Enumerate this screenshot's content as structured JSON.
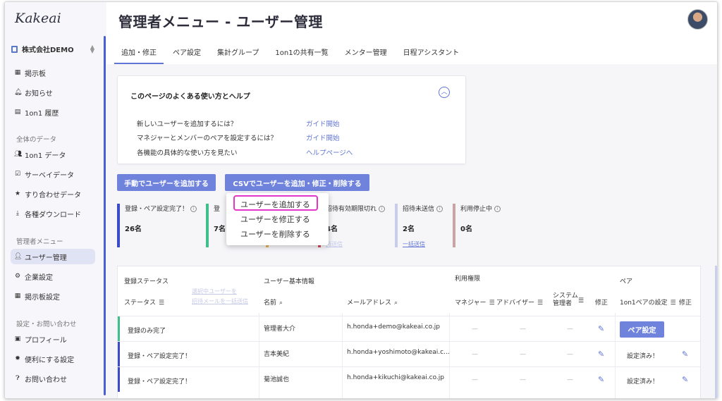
{
  "app": {
    "logo": "Kakeai"
  },
  "sidebar": {
    "company": "株式会社DEMO",
    "items_top": [
      {
        "label": "掲示板",
        "icon": "board-icon"
      },
      {
        "label": "お知らせ",
        "icon": "bell-icon"
      },
      {
        "label": "1on1 履歴",
        "icon": "history-icon"
      }
    ],
    "section_data": "全体のデータ",
    "items_data": [
      {
        "label": "1on1 データ",
        "icon": "people-icon"
      },
      {
        "label": "サーベイデータ",
        "icon": "survey-icon"
      },
      {
        "label": "すり合わせデータ",
        "icon": "star-icon"
      },
      {
        "label": "各種ダウンロード",
        "icon": "download-icon"
      }
    ],
    "section_admin": "管理者メニュー",
    "items_admin": [
      {
        "label": "ユーザー管理",
        "icon": "user-manage-icon"
      },
      {
        "label": "企業設定",
        "icon": "company-settings-icon"
      },
      {
        "label": "掲示板設定",
        "icon": "board-settings-icon"
      }
    ],
    "section_settings": "設定・お問い合わせ",
    "items_settings": [
      {
        "label": "プロフィール",
        "icon": "profile-icon"
      },
      {
        "label": "便利にする設定",
        "icon": "gear-icon"
      },
      {
        "label": "お問い合わせ",
        "icon": "help-icon"
      }
    ]
  },
  "header": {
    "title": "管理者メニュー - ユーザー管理"
  },
  "tabs": [
    "追加・修正",
    "ペア設定",
    "集計グループ",
    "1on1の共有一覧",
    "メンター管理",
    "日程アシスタント"
  ],
  "help": {
    "title": "このページのよくある使い方とヘルプ",
    "rows": [
      {
        "q": "新しいユーザーを追加するには？",
        "link": "ガイド開始"
      },
      {
        "q": "マネジャーとメンバーのペアを設定するには？",
        "link": "ガイド開始"
      },
      {
        "q": "各機能の具体的な使い方を見たい",
        "link": "ヘルプページへ"
      }
    ]
  },
  "buttons": {
    "manual_add": "手動でユーザーを追加する",
    "csv": "CSVでユーザーを追加・修正・削除する"
  },
  "dropdown": [
    "ユーザーを追加する",
    "ユーザーを修正する",
    "ユーザーを削除する"
  ],
  "stats": [
    {
      "label": "登録・ペア設定完了！",
      "value": "26名",
      "color": "#3c4cc9"
    },
    {
      "label": "登",
      "value": "7名",
      "color": "#3fbf8c"
    },
    {
      "label": "招待有効期限切れ",
      "value": "4名",
      "color": "#d94a5a",
      "link": "再送信"
    },
    {
      "label": "招待未送信",
      "value": "2名",
      "color": "#c8cee8",
      "link": "一括送信"
    },
    {
      "label": "利用停止中",
      "value": "0名",
      "color": "#c9a4a4"
    }
  ],
  "table": {
    "group_headers": {
      "status": "登録ステータス",
      "basic": "ユーザー基本情報",
      "permissions": "利用権限",
      "pair": "ペア"
    },
    "col_status": "ステータス",
    "col_name": "名前",
    "col_email": "メールアドレス",
    "col_manager": "マネジャー",
    "col_advisor": "アドバイザー",
    "col_sysadmin": "システム\n管理者",
    "col_edit": "修正",
    "col_pair": "1on1ペアの設定",
    "col_pair_edit": "修正",
    "faint_links": [
      "選択中ユーザーを",
      "招待メールを一括送信"
    ],
    "pair_button": "ペア設定",
    "rows": [
      {
        "status": "登録のみ完了",
        "name": "管理者大介",
        "email": "h.honda+demo@kakeai.co.jp",
        "pair": "",
        "color": "#3fbf8c"
      },
      {
        "status": "登録・ペア設定完了！",
        "name": "吉本美紀",
        "email": "h.honda+yoshimoto@kakeai.c...",
        "pair": "設定済み！",
        "color": "#3c4cc9"
      },
      {
        "status": "登録・ペア設定完了！",
        "name": "菊池誠也",
        "email": "h.honda+kikuchi@kakeai.co.jp",
        "pair": "設定済み！",
        "color": "#3c4cc9"
      }
    ],
    "dash": "—"
  }
}
